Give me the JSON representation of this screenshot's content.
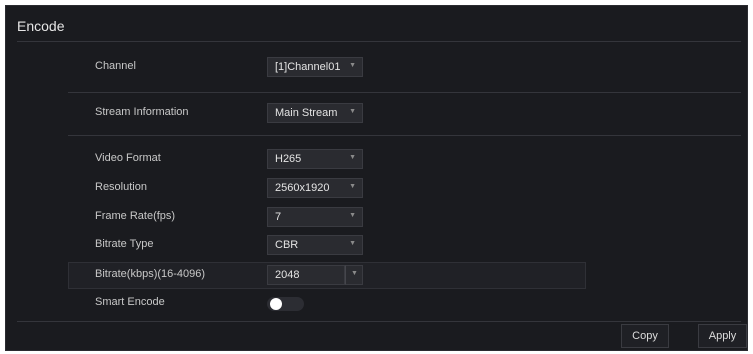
{
  "panel": {
    "title": "Encode"
  },
  "fields": {
    "channel": {
      "label": "Channel",
      "value": "[1]Channel01"
    },
    "stream_information": {
      "label": "Stream Information",
      "value": "Main Stream"
    },
    "video_format": {
      "label": "Video Format",
      "value": "H265"
    },
    "resolution": {
      "label": "Resolution",
      "value": "2560x1920"
    },
    "frame_rate": {
      "label": "Frame Rate(fps)",
      "value": "7"
    },
    "bitrate_type": {
      "label": "Bitrate Type",
      "value": "CBR"
    },
    "bitrate": {
      "label": "Bitrate(kbps)(16-4096)",
      "value": "2048"
    },
    "smart_encode": {
      "label": "Smart Encode",
      "enabled": true
    }
  },
  "icons": {
    "dropdown": "chevron-down-icon",
    "dropdown_glyph": "▼"
  },
  "buttons": {
    "copy": "Copy",
    "apply": "Apply"
  },
  "colors": {
    "background": "#1a1b1f",
    "field_bg": "#2a2b30",
    "text": "#c8c8c8",
    "toggle_knob": "#ffffff"
  }
}
